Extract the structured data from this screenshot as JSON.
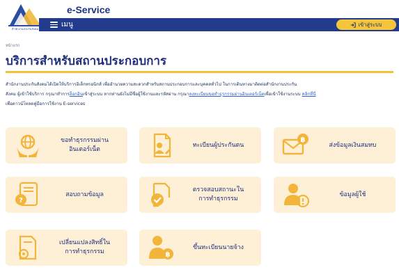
{
  "header": {
    "brand": "e-Service",
    "menu_label": "เมนู",
    "login_label": "เข้าสู่ระบบ",
    "logo_caption": "สำนักงานประกันสังคม"
  },
  "breadcrumb": "หน้าแรก",
  "page_title": "บริการสำหรับสถานประกอบการ",
  "intro": {
    "line1": "สำนักงานประกันสังคมได้เปิดให้บริการอิเล็กทรอนิกส์ เพื่ออำนวยความสะดวกสำหรับสถานประกอบการและบุคคลทั่วไป ในการเดินทางมาติดต่อสำนักงานประกัน",
    "line2_a": "สังคม ผู้เข้าใช้บริการ กรุณาทำการ",
    "line2_link1": "ล็อกอิน",
    "line2_b": "เข้าสู่ระบบ หากท่านยังไม่มีชื่อผู้ใช้งานและรหัสผ่าน กรุณา",
    "line2_link2": "ลงทะเบียนขอทำธุรกรรมผ่านอินเตอร์เน็ต",
    "line2_c": "เพื่อเข้าใช้งานระบบ ",
    "line2_link3": "คลิกที่นี่",
    "line3": "เพื่อดาวน์โหลดคู่มือการใช้งาน E-services"
  },
  "cards": [
    {
      "label_line1": "ขอทำธุรกรรมผ่าน",
      "label_line2": "อินเตอร์เน็ต",
      "icon": "globe-hands-icon"
    },
    {
      "label_line1": "ทะเบียนผู้ประกันตน",
      "label_line2": "",
      "icon": "register-insured-icon"
    },
    {
      "label_line1": "ส่งข้อมูลเงินสมทบ",
      "label_line2": "",
      "icon": "contribution-mail-icon"
    },
    {
      "label_line1": "สอบถามข้อมูล",
      "label_line2": "",
      "icon": "inquiry-icon"
    },
    {
      "label_line1": "ตรวจสอบสถานะใน",
      "label_line2": "การทำธุรกรรม",
      "icon": "status-check-icon"
    },
    {
      "label_line1": "ข้อมูลผู้ใช้",
      "label_line2": "",
      "icon": "user-info-icon"
    },
    {
      "label_line1": "เปลี่ยนแปลงสิทธิ์ใน",
      "label_line2": "การทำธุรกรรม",
      "icon": "change-rights-icon"
    },
    {
      "label_line1": "ขึ้นทะเบียนนายจ้าง",
      "label_line2": "",
      "icon": "employer-register-icon"
    }
  ],
  "colors": {
    "navy": "#233b8c",
    "yellow": "#f5c63b",
    "card_bg": "#fdf0d6",
    "icon_orange": "#f3b43a"
  }
}
